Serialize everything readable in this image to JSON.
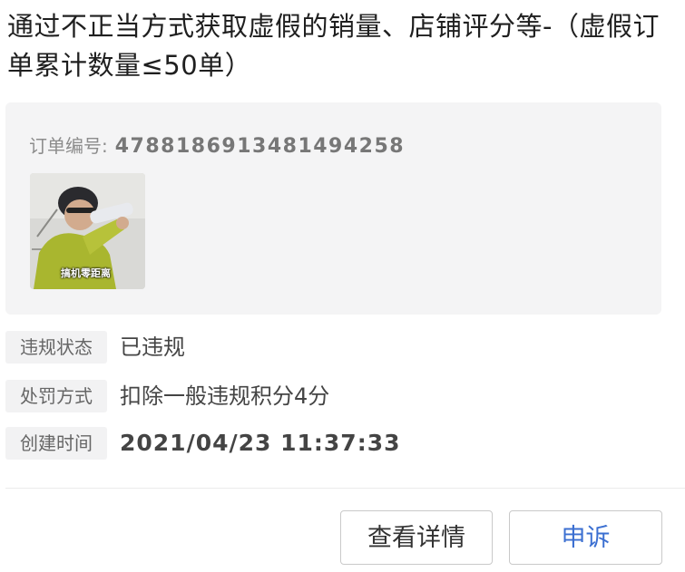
{
  "violation": {
    "title": "通过不正当方式获取虚假的销量、店铺评分等-（虚假订单累计数量≤50单）"
  },
  "order": {
    "label": "订单编号:",
    "number": "4788186913481494258",
    "thumbnail_caption": "搞机零距离"
  },
  "details": [
    {
      "label": "违规状态",
      "value": "已违规"
    },
    {
      "label": "处罚方式",
      "value": "扣除一般违规积分4分"
    },
    {
      "label": "创建时间",
      "value": "2021/04/23 11:37:33"
    }
  ],
  "actions": {
    "detail_label": "查看详情",
    "appeal_label": "申诉"
  },
  "colors": {
    "appeal_text": "#3b6fd1",
    "card_bg": "#f4f4f5"
  }
}
